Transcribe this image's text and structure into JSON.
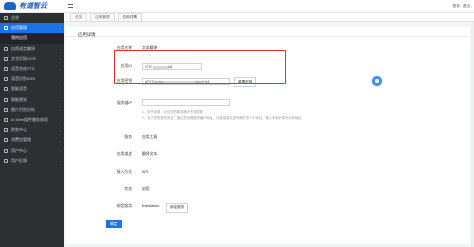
{
  "brand": {
    "name": "有道智云"
  },
  "sidebar": {
    "items": [
      {
        "label": "总览",
        "arrow": ""
      },
      {
        "label": "应用管理",
        "arrow": "▾",
        "active": true
      },
      {
        "label": "我的应用",
        "sub": true,
        "arrow": ""
      },
      {
        "label": "自然语言翻译",
        "arrow": "›"
      },
      {
        "label": "文字识别OCR",
        "arrow": "›"
      },
      {
        "label": "语音合成TTS",
        "arrow": "›"
      },
      {
        "label": "语音识别ASR",
        "arrow": "›"
      },
      {
        "label": "智能语音",
        "arrow": "›"
      },
      {
        "label": "智能视觉",
        "arrow": "›"
      },
      {
        "label": "图片识别分析",
        "arrow": "›"
      },
      {
        "label": "AI Web组件服务体验",
        "arrow": "›"
      },
      {
        "label": "财务中心",
        "arrow": "›"
      },
      {
        "label": "消费包管理",
        "arrow": "›"
      },
      {
        "label": "用户中心",
        "arrow": "›"
      },
      {
        "label": "用户反馈",
        "arrow": "›"
      }
    ]
  },
  "topbar": {
    "user": "登录",
    "logout": "退出"
  },
  "tabs": [
    {
      "label": "总览"
    },
    {
      "label": "应用管理"
    },
    {
      "label": "应用详情",
      "current": true
    }
  ],
  "card": {
    "title": "应用详情",
    "fields": {
      "app_name_label": "应用名称",
      "app_name_value": "文本翻译",
      "app_id_label": "应用ID",
      "app_id_value": "0757",
      "app_id_tail": "a8",
      "app_key_label": "应用密钥",
      "app_key_value": "APYTcuimw",
      "app_key_tail": "lxwmrYe5",
      "reset_button": "重置密钥",
      "server_ip_label": "服务器IP",
      "server_ip_hint1": "1、如不设置，对访问的服务器IP不设限制",
      "server_ip_hint2": "2、为了您的账号安全，建议您设置服务器IP地址，请使用英文逗号隔开多个IP地址，输入本机IP填写示例地址",
      "service_label": "服务",
      "service_value": "应用工具",
      "desc_label": "应用描述",
      "desc_value": "翻译文本",
      "access_label": "接入方式",
      "access_value": "API",
      "status_label": "状态",
      "status_value": "启用",
      "bind_label": "绑定服务",
      "bind_value": "translation",
      "bind_button": "绑定服务"
    },
    "submit": "确定"
  },
  "colors": {
    "accent": "#1a73e8",
    "sidebar": "#2d2f33",
    "highlight": "#e0322b"
  }
}
